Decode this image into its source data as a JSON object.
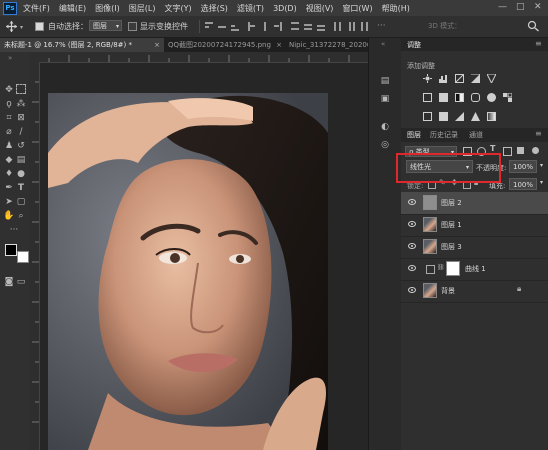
{
  "menu": {
    "logo": "Ps",
    "items": [
      "文件(F)",
      "编辑(E)",
      "图像(I)",
      "图层(L)",
      "文字(Y)",
      "选择(S)",
      "滤镜(T)",
      "3D(D)",
      "视图(V)",
      "窗口(W)",
      "帮助(H)"
    ],
    "window_buttons": [
      "—",
      "□",
      "✕"
    ]
  },
  "options": {
    "auto_select_label": "自动选择：",
    "auto_select_value": "图层",
    "show_transform_label": "显示变换控件",
    "mode_3d_label": "3D 模式："
  },
  "tabs": [
    {
      "label": "未标题-1 @ 16.7% (图层 2, RGB/8#) *",
      "active": true,
      "close": "×"
    },
    {
      "label": "QQ截图20200724172945.png",
      "active": false,
      "close": "×"
    },
    {
      "label": "Nipic_31372278_20200706090…",
      "active": false,
      "close": ""
    }
  ],
  "panels": {
    "adjust_tab": "调整",
    "add_adjustment": "添加调整",
    "layer_tabs": [
      "图层",
      "历史记录",
      "通道"
    ],
    "filter_kind": "ρ 类型",
    "blend_mode": "线性光",
    "opacity_label": "不透明度:",
    "opacity_value": "100%",
    "lock_label": "锁定:",
    "fill_label": "填充:",
    "fill_value": "100%"
  },
  "layers": [
    {
      "name": "图层 2",
      "selected": true,
      "type": "gray"
    },
    {
      "name": "图层 1",
      "selected": false,
      "type": "photo"
    },
    {
      "name": "图层 3",
      "selected": false,
      "type": "photo"
    },
    {
      "name": "曲线 1",
      "selected": false,
      "type": "curves"
    },
    {
      "name": "背景",
      "selected": false,
      "type": "photo",
      "locked": true
    }
  ],
  "colors": {
    "accent_red": "#e0282c",
    "ps_blue": "#31a8ff",
    "panel_bg": "#2f2f2f"
  },
  "icons": [
    "move-icon",
    "marquee-icon",
    "lasso-icon",
    "magic-wand-icon",
    "crop-icon",
    "eyedropper-icon",
    "healing-icon",
    "brush-icon",
    "stamp-icon",
    "history-brush-icon",
    "eraser-icon",
    "gradient-icon",
    "blur-icon",
    "dodge-icon",
    "pen-icon",
    "type-icon",
    "path-select-icon",
    "rectangle-icon",
    "hand-icon",
    "zoom-icon",
    "more-icon",
    "eye-icon",
    "lock-icon"
  ]
}
